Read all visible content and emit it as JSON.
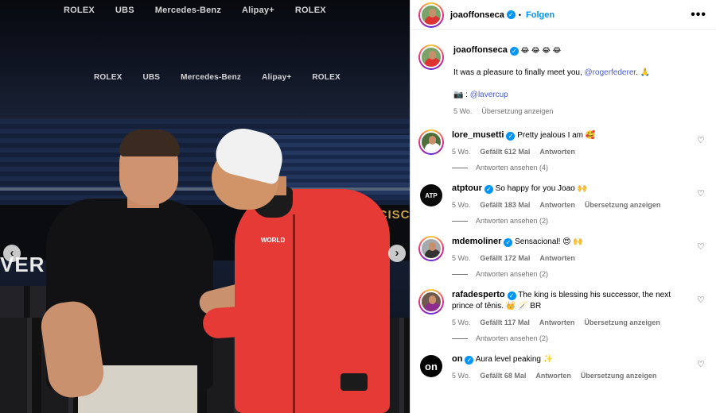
{
  "photo": {
    "banner_top": [
      "ROLEX",
      "UBS",
      "Mercedes-Benz",
      "Alipay+",
      "ROLEX"
    ],
    "banner_mid": [
      "ROLEX",
      "UBS",
      "Mercedes-Benz",
      "Alipay+",
      "ROLEX"
    ],
    "board_left": "VER CUP",
    "board_right": "FRANCISCO",
    "jacket_logo": "WORLD",
    "arrow_left": "‹",
    "arrow_right": "›"
  },
  "header": {
    "username": "joaoffonseca",
    "separator": "•",
    "follow_label": "Folgen",
    "more_label": "•••"
  },
  "caption": {
    "username": "joaoffonseca",
    "emojis": "😂 😂 😂 😂",
    "text_prefix": "It was a pleasure to finally meet you, ",
    "mention": "@rogerfederer",
    "text_suffix": ". 🙏",
    "credit_prefix": "📷 : ",
    "credit_mention": "@lavercup",
    "time": "5 Wo.",
    "translate": "Übersetzung anzeigen"
  },
  "comments": [
    {
      "username": "lore_musetti",
      "text": "Pretty jealous I am 🥰",
      "time": "5 Wo.",
      "likes": "Gefällt 612 Mal",
      "reply": "Antworten",
      "translate": "",
      "view_replies": "Antworten ansehen (4)"
    },
    {
      "username": "atptour",
      "text": "So happy for you Joao 🙌",
      "time": "5 Wo.",
      "likes": "Gefällt 183 Mal",
      "reply": "Antworten",
      "translate": "Übersetzung anzeigen",
      "view_replies": "Antworten ansehen (2)"
    },
    {
      "username": "mdemoliner",
      "text": "Sensacional! 😍 🙌",
      "time": "5 Wo.",
      "likes": "Gefällt 172 Mal",
      "reply": "Antworten",
      "translate": "",
      "view_replies": "Antworten ansehen (2)"
    },
    {
      "username": "rafadesperto",
      "text": "The king is blessing his successor, the next prince of tênis. 👑 🪄 BR",
      "time": "5 Wo.",
      "likes": "Gefällt 117 Mal",
      "reply": "Antworten",
      "translate": "Übersetzung anzeigen",
      "view_replies": "Antworten ansehen (2)"
    },
    {
      "username": "on",
      "text": "Aura level peaking ✨",
      "time": "5 Wo.",
      "likes": "Gefällt 68 Mal",
      "reply": "Antworten",
      "translate": "Übersetzung anzeigen",
      "view_replies": ""
    }
  ],
  "avatars": {
    "atptour": "ATP",
    "on": "on"
  },
  "colors": {
    "accent": "#0095f6",
    "mention": "#4a5ccf",
    "jacket": "#e63a36"
  }
}
